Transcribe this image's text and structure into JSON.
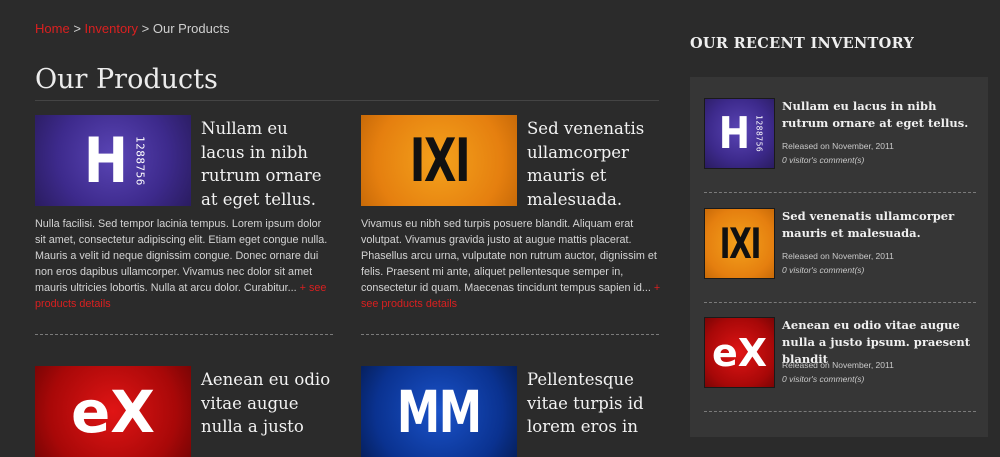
{
  "breadcrumb": {
    "home": "Home",
    "sep1": ">",
    "inventory": "Inventory",
    "sep2": ">",
    "current": "Our Products"
  },
  "page_title": "Our Products",
  "products": [
    {
      "logo_text": "H",
      "logo_number": "1288756",
      "title": "Nullam eu lacus in nibh rutrum ornare at eget tellus.",
      "description": "Nulla facilisi. Sed tempor lacinia tempus. Lorem ipsum dolor sit amet, consectetur adipiscing elit. Etiam eget congue nulla. Mauris a velit id neque dignissim congue. Donec ornare dui non eros dapibus ullamcorper. Vivamus nec dolor sit amet mauris ultricies lobortis. Nulla at arcu dolor. Curabitur...",
      "more": "+ see products details"
    },
    {
      "logo_text": "IXI",
      "title": "Sed venenatis ullamcorper mauris et malesuada.",
      "description": "Vivamus eu nibh sed turpis posuere blandit. Aliquam erat volutpat. Vivamus gravida justo at augue mattis placerat. Phasellus arcu urna, vulputate non rutrum auctor, dignissim et felis. Praesent mi ante, aliquet pellentesque semper in, consectetur id quam. Maecenas tincidunt tempus sapien id...",
      "more": "+ see products details"
    },
    {
      "logo_text": "eX",
      "title": "Aenean eu odio vitae augue nulla a justo"
    },
    {
      "logo_text": "MM",
      "title": "Pellentesque vitae turpis id lorem eros in"
    }
  ],
  "sidebar": {
    "heading": "OUR RECENT INVENTORY",
    "items": [
      {
        "logo_text": "H",
        "logo_number": "1288756",
        "title": "Nullam eu lacus in nibh rutrum ornare at eget tellus.",
        "date": "Released on November, 2011",
        "comments": "0 visitor's comment(s)"
      },
      {
        "logo_text": "IXI",
        "title": "Sed venenatis ullamcorper mauris et malesuada.",
        "date": "Released on November, 2011",
        "comments": "0 visitor's comment(s)"
      },
      {
        "logo_text": "eX",
        "title": "Aenean eu odio vitae augue nulla a justo ipsum. praesent blandit",
        "date": "Released on November, 2011",
        "comments": "0 visitor's comment(s)"
      }
    ]
  },
  "colors": {
    "background": "#2b2b2b",
    "accent_red": "#d92020",
    "panel": "#363636"
  }
}
